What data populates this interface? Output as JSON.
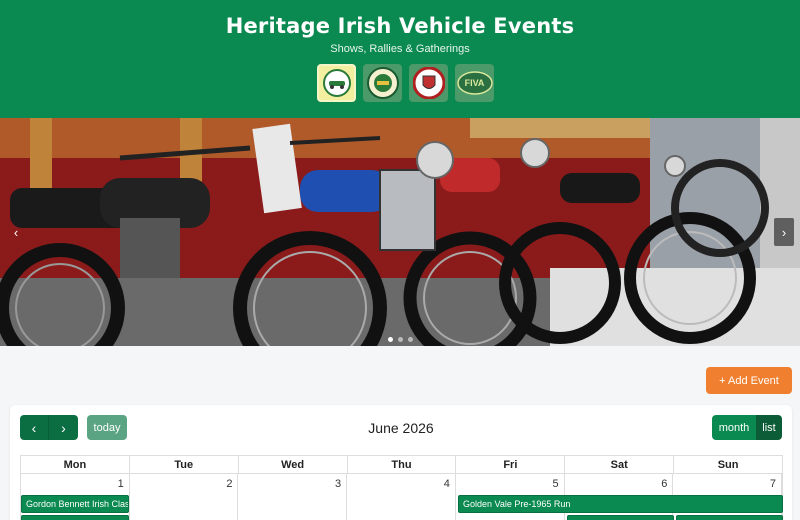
{
  "header": {
    "title": "Heritage Irish Vehicle Events",
    "subtitle": "Shows, Rallies & Gatherings",
    "logos": [
      {
        "name": "club-logo-1"
      },
      {
        "name": "club-logo-2"
      },
      {
        "name": "club-logo-3"
      },
      {
        "name": "club-logo-fiva",
        "text": "FIVA"
      }
    ]
  },
  "hero": {
    "prev_icon": "‹",
    "next_icon": "›",
    "slides": 3,
    "active_slide": 0
  },
  "actions": {
    "add_event_label": "+ Add Event"
  },
  "calendar": {
    "prev_icon": "‹",
    "next_icon": "›",
    "today_label": "today",
    "title": "June 2026",
    "views": {
      "month": "month",
      "list": "list"
    },
    "weekdays": [
      "Mon",
      "Tue",
      "Wed",
      "Thu",
      "Fri",
      "Sat",
      "Sun"
    ],
    "week1_days": [
      "1",
      "2",
      "3",
      "4",
      "5",
      "6",
      "7"
    ],
    "events": {
      "gordon_bennett": "Gordon Bennett Irish Class",
      "golden_vale": "Golden Vale Pre-1965 Run"
    }
  },
  "colors": {
    "brand_green": "#0a8a50",
    "accent_orange": "#f08030"
  }
}
